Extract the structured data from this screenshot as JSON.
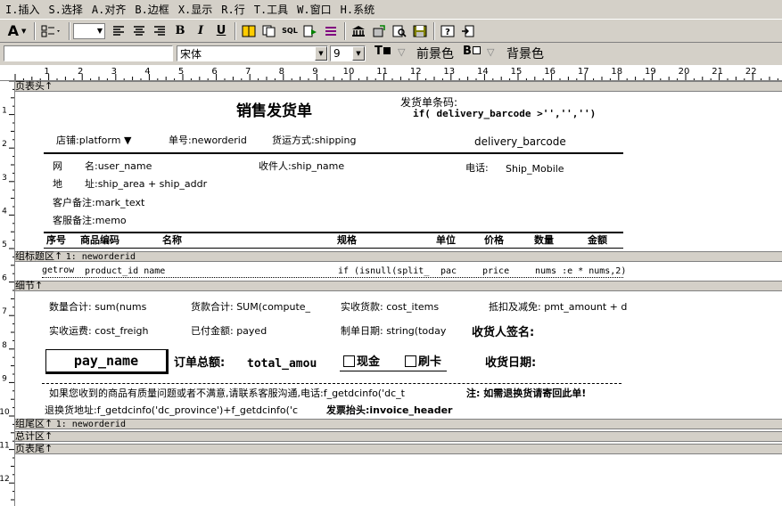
{
  "menu": [
    "I.插入",
    "S.选择",
    "A.对齐",
    "B.边框",
    "X.显示",
    "R.行",
    "T.工具",
    "W.窗口",
    "H.系统"
  ],
  "toolbar": {
    "font_btn": "A",
    "bold": "B",
    "italic": "I",
    "underline": "U",
    "sql": "SQL"
  },
  "fontbar": {
    "font_name": "宋体",
    "font_size": "9",
    "fg_label": "前景色",
    "bg_label": "背景色",
    "underline_glyph": "T",
    "border_glyph": "B"
  },
  "ruler": {
    "top": [
      "1",
      "2",
      "3",
      "4",
      "5",
      "6",
      "7",
      "8",
      "9",
      "10",
      "11",
      "12",
      "13",
      "14",
      "15",
      "16",
      "17",
      "18",
      "19",
      "20",
      "21",
      "22"
    ],
    "left": [
      "1",
      "2",
      "3",
      "4",
      "5",
      "6",
      "7",
      "8",
      "9",
      "10",
      "11",
      "12"
    ]
  },
  "bands": {
    "header": "页表头↑",
    "group_header": "组标题区↑",
    "group_header_expr": "1: neworderid",
    "detail": "细节↑",
    "group_footer": "组尾区↑",
    "group_footer_expr": "1: neworderid",
    "summary": "总计区↑",
    "footer": "页表尾↑"
  },
  "report": {
    "title": "销售发货单",
    "barcode_label": "发货单条码:",
    "barcode_expr": "if( delivery_barcode >'','','')",
    "shop_label": "店铺:platform ▼",
    "order_label": "单号:neworderid",
    "ship_method": "货运方式:shipping",
    "barcode_field": "delivery_barcode",
    "net_label": "网",
    "net_label2": "名:user_name",
    "receiver": "收件人:ship_name",
    "phone_label": "电话:",
    "phone_value": "Ship_Mobile",
    "addr_label": "地",
    "addr_label2": "址:ship_area + ship_addr",
    "cust_note": "客户备注:mark_text",
    "cs_note": "客服备注:memo",
    "col_headers": [
      "序号",
      "商品编码",
      "名称",
      "规格",
      "单位",
      "价格",
      "数量",
      "金额"
    ],
    "detail_cells": [
      "getrow",
      "product_id name",
      "if (isnull(split_",
      "pac",
      "price",
      "nums :e * nums,2)"
    ],
    "qty_total": "数量合计: sum(nums",
    "goods_total": "货款合计: SUM(compute_",
    "received": "实收货款: cost_items",
    "discount": "抵扣及减免: pmt_amount + d",
    "freight": "实收运费: cost_freigh",
    "paid": "已付金额: payed",
    "made_date": "制单日期: string(today",
    "sign": "收货人签名:",
    "pay_name": "pay_name",
    "order_total": "订单总额:",
    "order_total_val": "total_amou",
    "cash": "现金",
    "card": "刷卡",
    "recv_date": "收货日期:",
    "notice": "如果您收到的商品有质量问题或者不满意,请联系客服沟通,电话:f_getdcinfo('dc_t",
    "notice_bold": "注: 如需退换货请寄回此单!",
    "return_addr": "退换货地址:f_getdcinfo('dc_province')+f_getdcinfo('c",
    "invoice": "发票抬头:invoice_header"
  }
}
